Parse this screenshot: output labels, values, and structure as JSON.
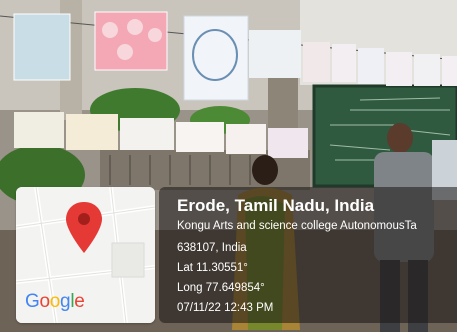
{
  "location": {
    "title": "Erode, Tamil Nadu, India",
    "address_line1": "Kongu Arts and science college AutonomousTa",
    "address_line2": "638107, India",
    "latitude": "Lat 11.30551°",
    "longitude": "Long 77.649854°",
    "datetime": "07/11/22 12:43 PM"
  },
  "map": {
    "logo_letters": [
      "G",
      "o",
      "o",
      "g",
      "l",
      "e"
    ],
    "logo_colors": [
      "#4285F4",
      "#EA4335",
      "#FBBC05",
      "#4285F4",
      "#34A853",
      "#EA4335"
    ],
    "pin_color": "#E53935",
    "pin_icon": "map-pin-icon"
  },
  "colors": {
    "panel_bg": "#191614",
    "panel_text": "#ffffff"
  }
}
